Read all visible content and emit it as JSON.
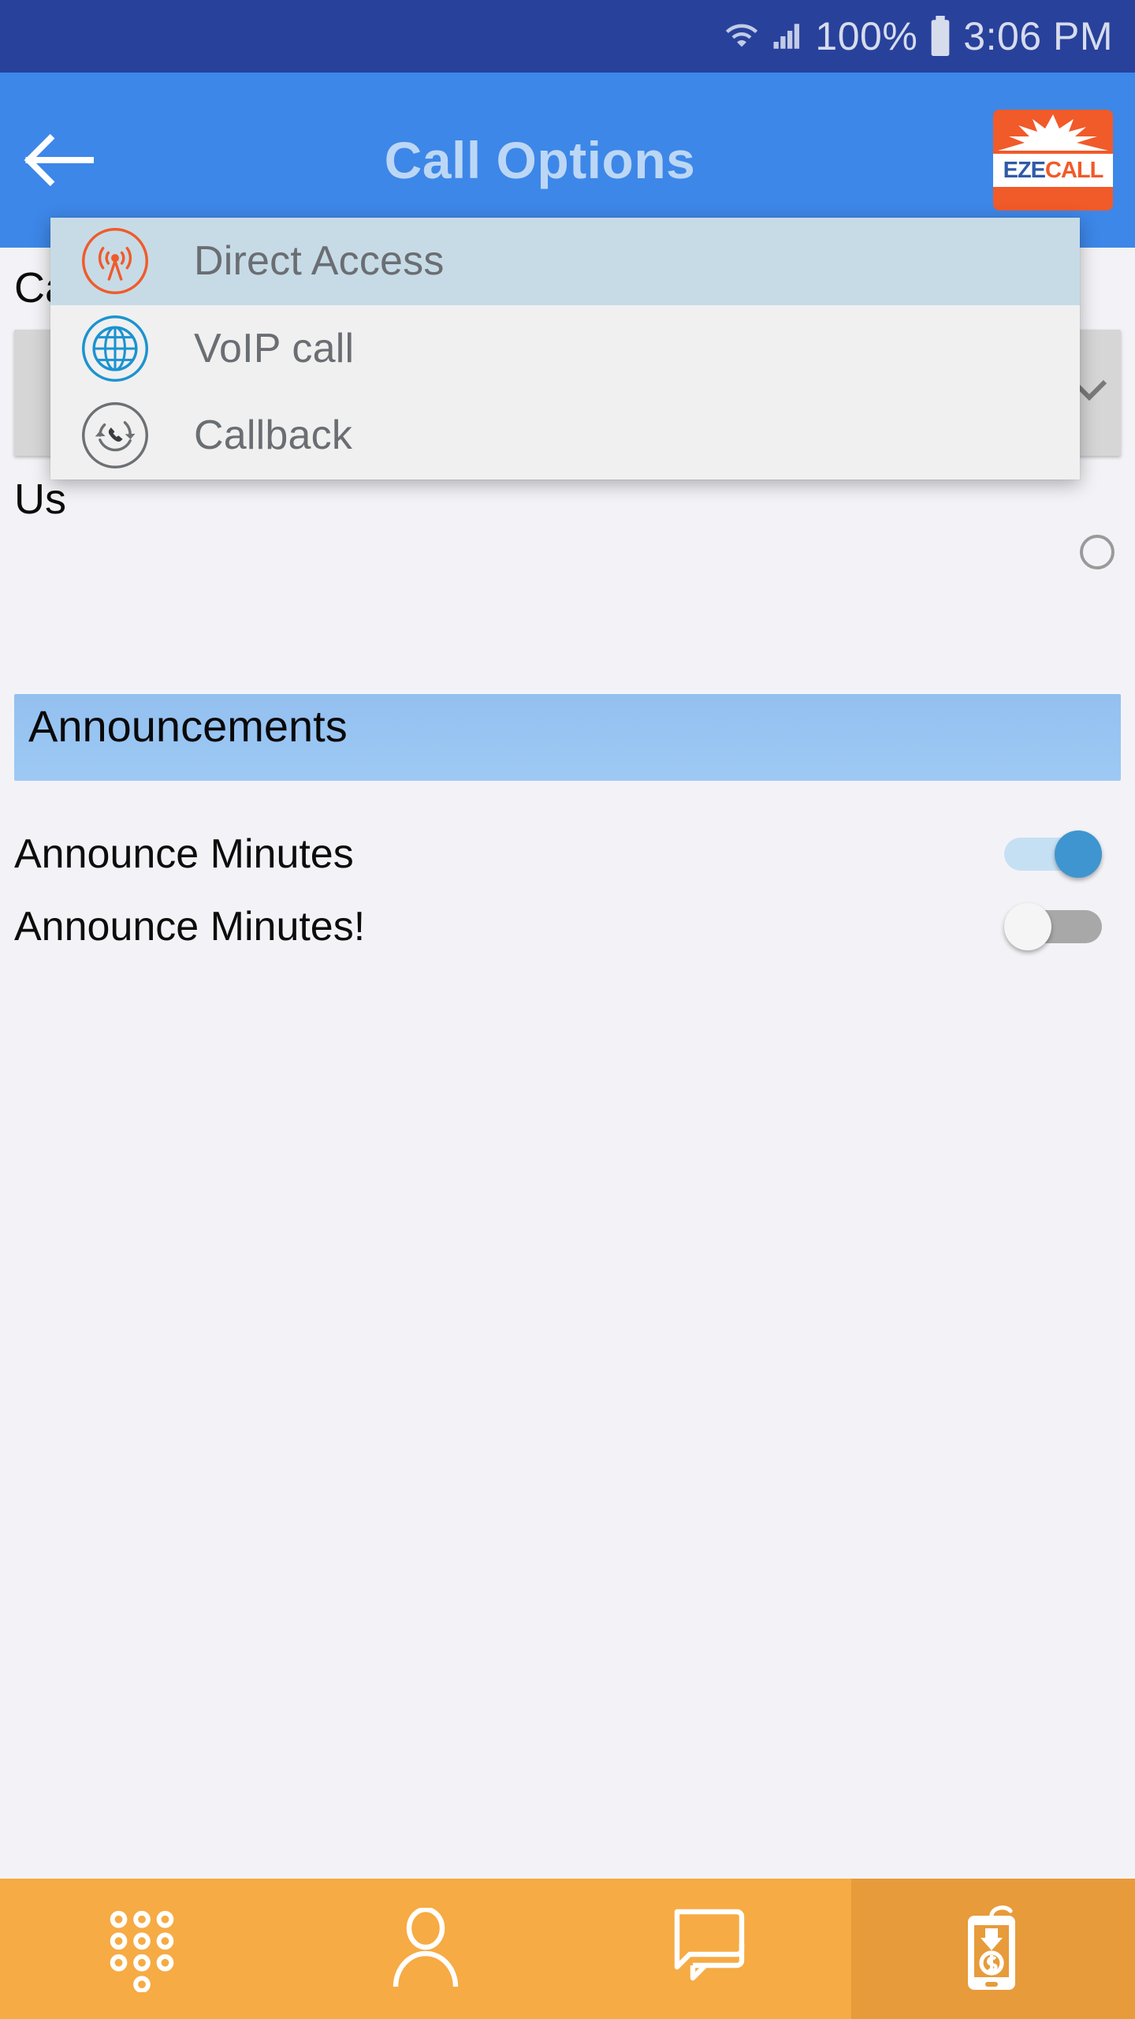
{
  "status_bar": {
    "wifi_icon": "wifi-icon",
    "signal_icon": "cellular-signal-icon",
    "battery_percent": "100%",
    "battery_icon": "battery-full-icon",
    "time": "3:06 PM"
  },
  "app_bar": {
    "back_icon": "back-arrow-icon",
    "title": "Call Options",
    "logo": {
      "name": "ezecall-logo",
      "text_primary": "EZE",
      "text_secondary": "CALL"
    }
  },
  "form": {
    "call_type_label": "Call Type:",
    "second_label": "Us",
    "section_header": "Announcements"
  },
  "dropdown": {
    "open": true,
    "items": [
      {
        "label": "Direct Access",
        "icon": "broadcast-tower-icon",
        "selected": true,
        "color": "#ef5b2b"
      },
      {
        "label": "VoIP call",
        "icon": "globe-icon",
        "selected": false,
        "color": "#1b93d0"
      },
      {
        "label": "Callback",
        "icon": "callback-phone-icon",
        "selected": false,
        "color": "#6d7073"
      }
    ]
  },
  "toggles": [
    {
      "label": "Announce Minutes",
      "state": "on"
    },
    {
      "label": "Announce Minutes!",
      "state": "off"
    }
  ],
  "bottom_nav": [
    {
      "name": "dialpad",
      "icon": "dialpad-icon",
      "active": false
    },
    {
      "name": "contacts",
      "icon": "person-icon",
      "active": false
    },
    {
      "name": "messages",
      "icon": "chat-bubbles-icon",
      "active": false
    },
    {
      "name": "recharge",
      "icon": "phone-money-icon",
      "active": true
    }
  ],
  "colors": {
    "status_bar": "#28419b",
    "app_bar": "#3d87e8",
    "accent_orange": "#f15a29",
    "nav_bar": "#f6ab44",
    "nav_active": "#e79b3b",
    "selected_row": "#c7dbe6",
    "toggle_on": "#3f95d0"
  }
}
